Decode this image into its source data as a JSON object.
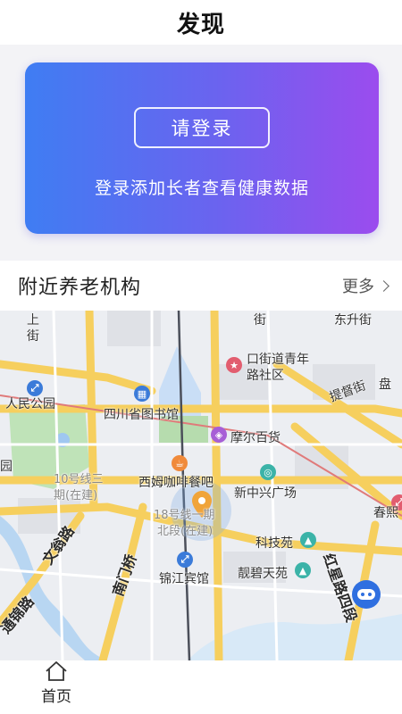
{
  "header": {
    "title": "发现"
  },
  "banner": {
    "login_label": "请登录",
    "subtitle": "登录添加长者查看健康数据",
    "gradient": [
      "#3f7df3",
      "#9b4cee"
    ]
  },
  "nearby": {
    "title": "附近养老机构",
    "more_label": "更多"
  },
  "map": {
    "labels": {
      "renmin_park": "人民公园",
      "sichuan_library": "四川省图书馆",
      "kou_street": "口街道青年",
      "lushe_community": "路社区",
      "morle": "摩尔百货",
      "ximu_cafe": "西姆咖啡餐吧",
      "xinzhongxing": "新中兴广场",
      "line10_a": "10号线三",
      "line10_b": "期(在建)",
      "line18_a": "18号线一期",
      "line18_b": "北段(在建)",
      "kejiyuan": "科技苑",
      "jinjiang_hotel": "锦江宾馆",
      "liangbi": "靓碧天苑",
      "tidu_street": "提督街",
      "wenweng_road": "文翁路",
      "nanmen_bridge": "南门桥",
      "hongxing_road": "红星路四段",
      "tongjin_road": "通锦路",
      "shang_street_a": "上",
      "shang_street_b": "街",
      "chunxi": "春熙",
      "pan": "盘",
      "yuan": "园",
      "top_a": "街",
      "top_b": "东升街"
    }
  },
  "bottom_nav": {
    "home_label": "首页"
  }
}
